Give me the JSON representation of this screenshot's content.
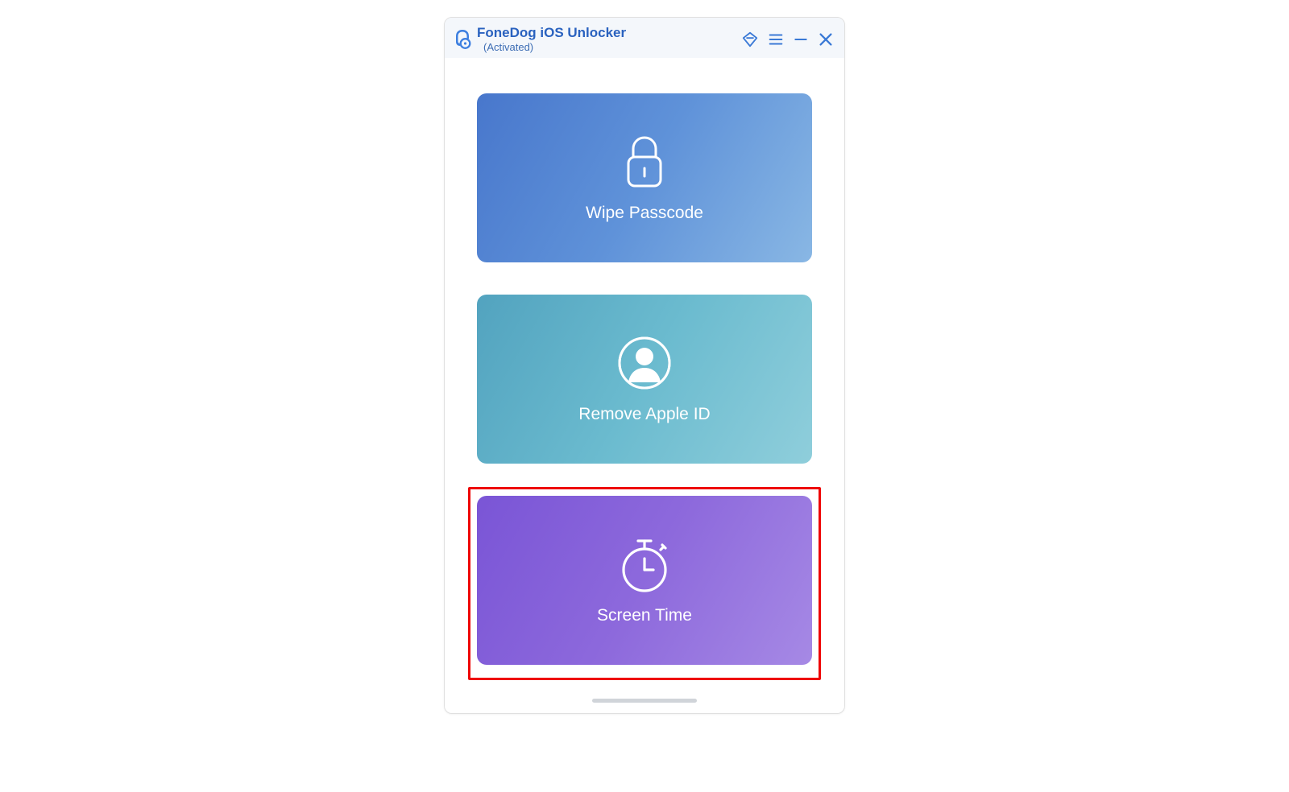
{
  "titlebar": {
    "app_title": "FoneDog iOS Unlocker",
    "status": "(Activated)"
  },
  "cards": {
    "wipe": {
      "label": "Wipe Passcode"
    },
    "apple": {
      "label": "Remove Apple ID"
    },
    "screen": {
      "label": "Screen Time"
    }
  }
}
